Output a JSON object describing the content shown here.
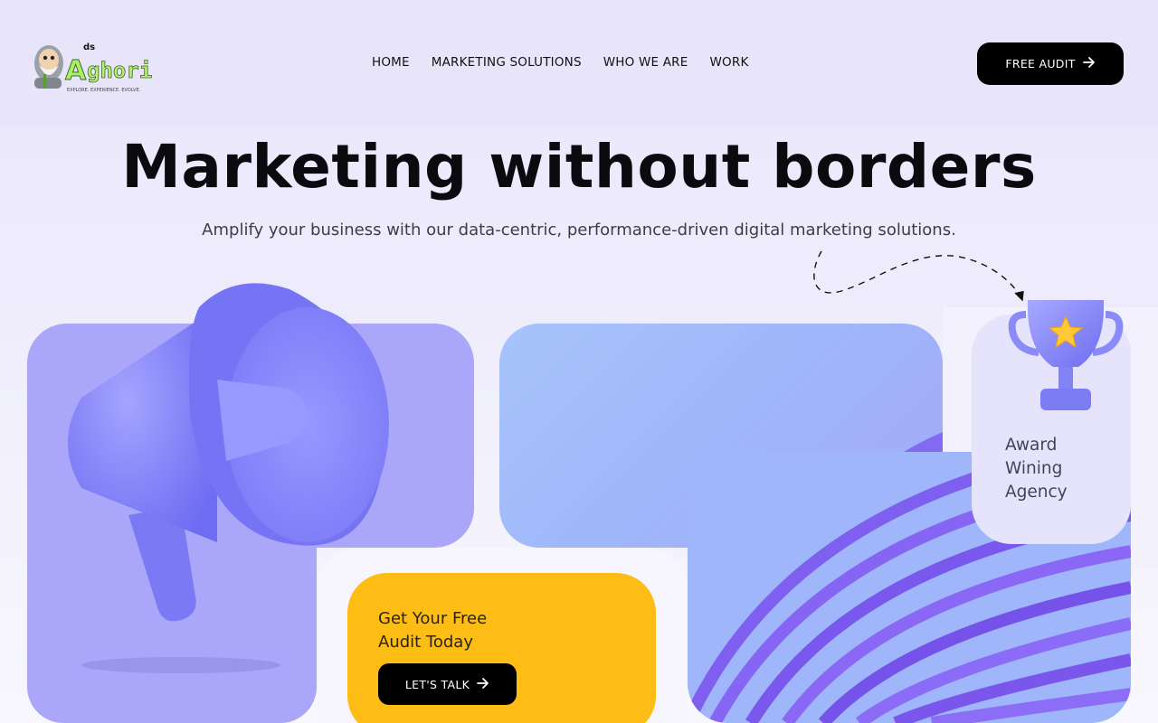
{
  "brand": {
    "logo_text": "Aghori",
    "logo_prefix": "ds",
    "logo_tagline": "EXPLORE. EXPERIENCE. EVOLVE."
  },
  "nav": {
    "items": [
      {
        "label": "HOME"
      },
      {
        "label": "MARKETING SOLUTIONS"
      },
      {
        "label": "WHO WE ARE"
      },
      {
        "label": "WORK"
      }
    ],
    "cta_label": "FREE AUDIT"
  },
  "hero": {
    "headline": "Marketing without borders",
    "subheadline": "Amplify your business with our data-centric, performance-driven digital marketing solutions."
  },
  "award_card": {
    "line1": "Award",
    "line2": "Wining",
    "line3": "Agency"
  },
  "audit_card": {
    "line1": "Get Your Free",
    "line2": "Audit Today",
    "cta_label": "LET'S TALK"
  },
  "icons": {
    "arrow": "arrow-right-icon",
    "megaphone": "megaphone-icon",
    "trophy": "trophy-icon"
  },
  "colors": {
    "background": "#e9e6fb",
    "accent_purple": "#aaa7fa",
    "accent_yellow": "#fdbd14",
    "button_bg": "#000000",
    "button_text": "#ffffff"
  }
}
